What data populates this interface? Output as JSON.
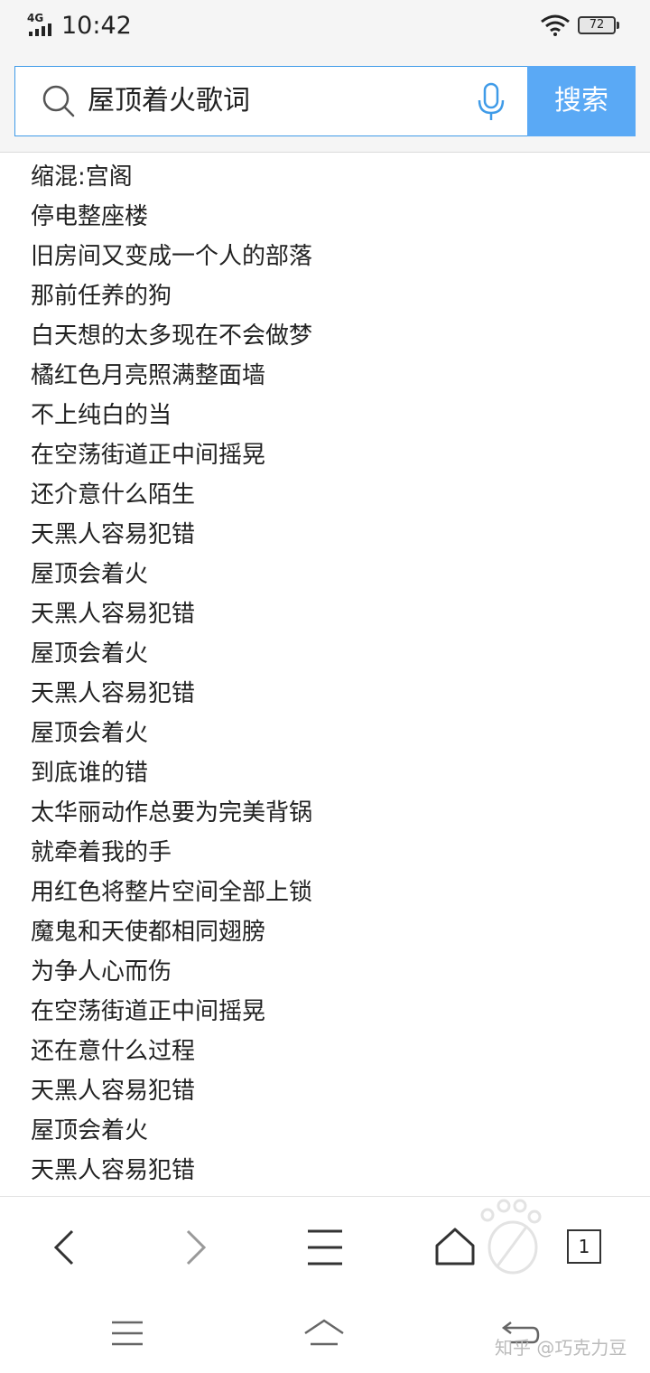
{
  "status_bar": {
    "network": "4G",
    "time": "10:42",
    "battery": "72"
  },
  "search": {
    "query": "屋顶着火歌词",
    "button_label": "搜索"
  },
  "lyrics": [
    "缩混:宫阁",
    "停电整座楼",
    "旧房间又变成一个人的部落",
    "那前任养的狗",
    "白天想的太多现在不会做梦",
    "橘红色月亮照满整面墙",
    "不上纯白的当",
    "在空荡街道正中间摇晃",
    "还介意什么陌生",
    "天黑人容易犯错",
    "屋顶会着火",
    "天黑人容易犯错",
    "屋顶会着火",
    "天黑人容易犯错",
    "屋顶会着火",
    "到底谁的错",
    "太华丽动作总要为完美背锅",
    "就牵着我的手",
    "用红色将整片空间全部上锁",
    "魔鬼和天使都相同翅膀",
    "为争人心而伤",
    "在空荡街道正中间摇晃",
    "还在意什么过程",
    "天黑人容易犯错",
    "屋顶会着火",
    "天黑人容易犯错"
  ],
  "toolbar": {
    "back_icon": "chevron-left-icon",
    "forward_icon": "chevron-right-icon",
    "menu_icon": "hamburger-icon",
    "home_icon": "home-icon",
    "tabs_count": "1"
  },
  "watermark": "知乎 @巧克力豆",
  "colors": {
    "accent": "#5aa9f5",
    "search_border": "#3f9be8",
    "text": "#222222",
    "header_bg": "#f5f5f5"
  }
}
